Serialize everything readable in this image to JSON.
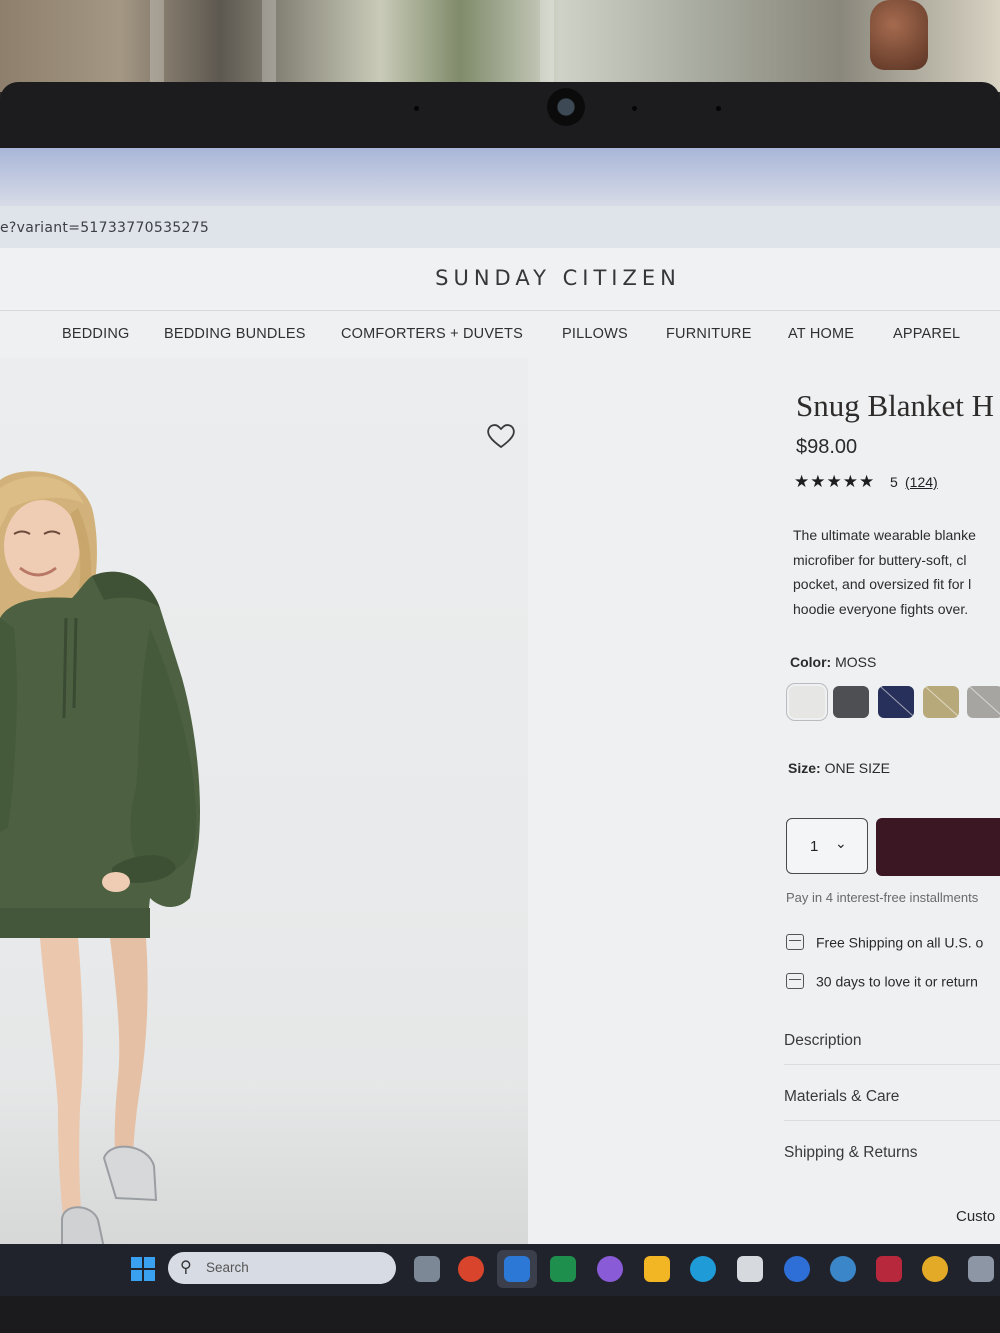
{
  "browser": {
    "url_fragment": "e?variant=51733770535275"
  },
  "site": {
    "logo": "SUNDAY CITIZEN",
    "nav": [
      "BEDDING",
      "BEDDING BUNDLES",
      "COMFORTERS + DUVETS",
      "PILLOWS",
      "FURNITURE",
      "AT HOME",
      "APPAREL"
    ]
  },
  "product": {
    "title": "Snug Blanket H",
    "price": "$98.00",
    "stars": "★★★★★",
    "rating": "5",
    "review_count": "(124)",
    "description_lines": [
      "The ultimate wearable blanke",
      "microfiber for buttery-soft, cl",
      "pocket, and oversized fit for l",
      "hoodie everyone fights over."
    ],
    "color_label": "Color:",
    "color_value": "MOSS",
    "swatches": [
      "#e6e6e4",
      "#4d4f52",
      "#27305a",
      "#b7a97a",
      "#a6a5a2"
    ],
    "size_label": "Size:",
    "size_value": "ONE SIZE",
    "quantity": "1",
    "installments": "Pay in 4 interest-free installments",
    "perks": [
      "Free Shipping on all U.S. o",
      "30 days to love it or return"
    ],
    "accordions": [
      "Description",
      "Materials & Care",
      "Shipping & Returns"
    ],
    "custom": "Custo"
  },
  "taskbar": {
    "search_placeholder": "Search"
  },
  "colors": {
    "add_to_cart": "#3b1723",
    "garment": "#4d6142"
  }
}
